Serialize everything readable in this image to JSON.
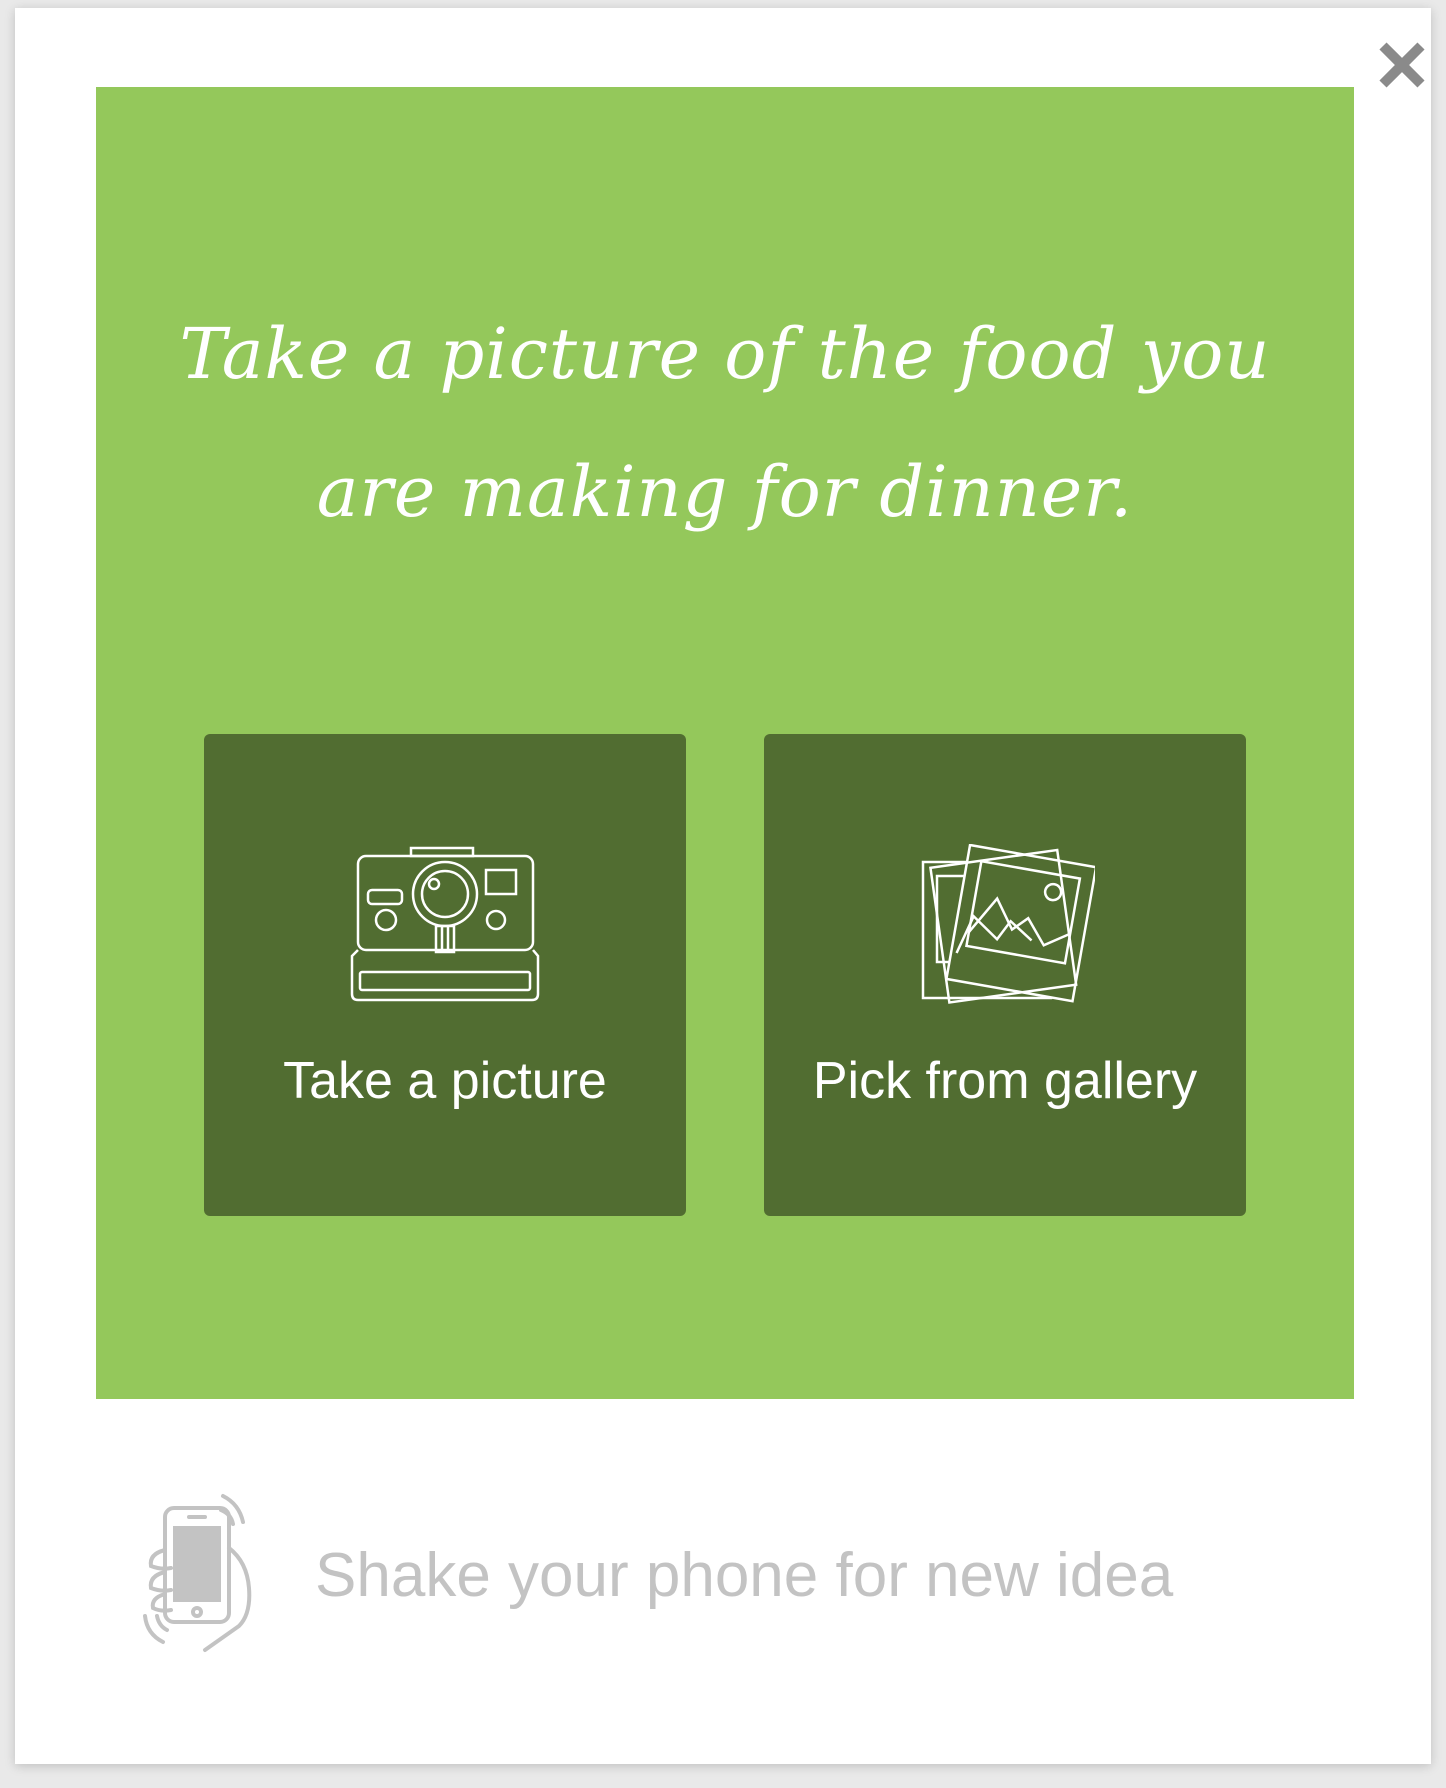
{
  "prompt": {
    "text": "Take a picture of the food you are making for dinner."
  },
  "options": {
    "take_picture": {
      "label": "Take a picture",
      "icon": "instant-camera-icon"
    },
    "pick_gallery": {
      "label": "Pick from gallery",
      "icon": "photo-gallery-icon"
    }
  },
  "footer": {
    "shake_text": "Shake your phone for new idea",
    "icon": "shake-phone-icon"
  },
  "close": {
    "icon": "close-icon"
  },
  "colors": {
    "panel": "#94c85b",
    "button": "#516d31",
    "footer_text": "#c3c3c3",
    "close": "#8a8a8a"
  }
}
